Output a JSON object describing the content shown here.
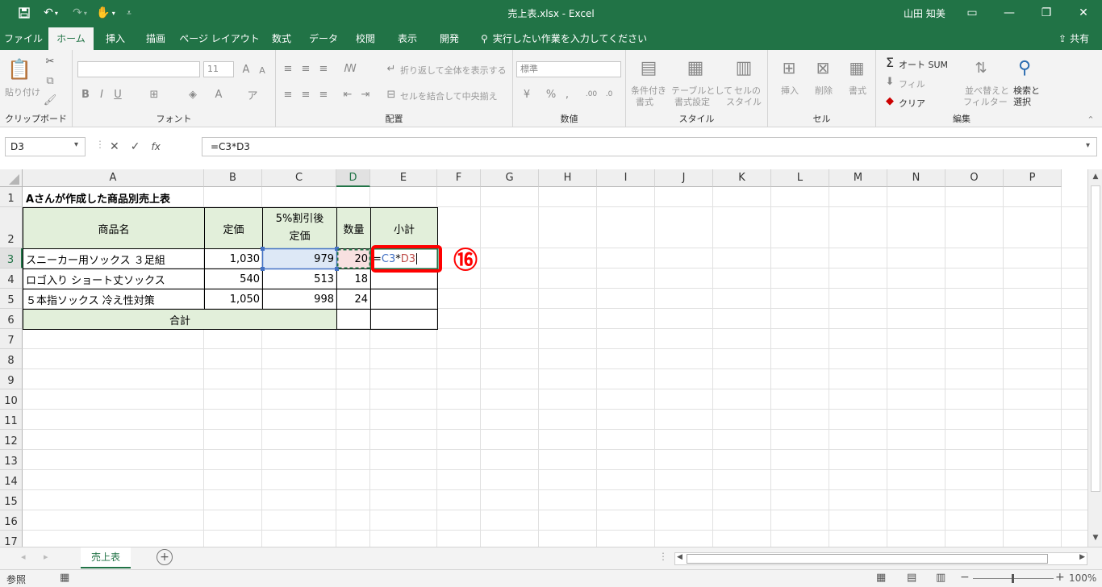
{
  "title_bar": {
    "title": "売上表.xlsx  -  Excel",
    "user": "山田 知美",
    "save_icon": "save-icon",
    "undo_icon": "undo-icon",
    "redo_icon": "redo-icon",
    "touch_icon": "touch-mode-icon",
    "customize_icon": "customize-qat-icon"
  },
  "tabs": [
    "ファイル",
    "ホーム",
    "挿入",
    "描画",
    "ページ レイアウト",
    "数式",
    "データ",
    "校閲",
    "表示",
    "開発"
  ],
  "active_tab": "ホーム",
  "tell_me": "実行したい作業を入力してください",
  "share": "共有",
  "ribbon": {
    "clipboard": {
      "label": "クリップボード",
      "paste": "貼り付け"
    },
    "font": {
      "label": "フォント",
      "size": "11"
    },
    "alignment": {
      "label": "配置",
      "wrap": "折り返して全体を表示する",
      "merge": "セルを結合して中央揃え"
    },
    "number": {
      "label": "数値",
      "format": "標準"
    },
    "styles": {
      "label": "スタイル",
      "conditional_1": "条件付き",
      "conditional_2": "書式",
      "table_1": "テーブルとして",
      "table_2": "書式設定",
      "cell_1": "セルの",
      "cell_2": "スタイル"
    },
    "cells": {
      "label": "セル",
      "insert": "挿入",
      "delete": "削除",
      "format": "書式"
    },
    "editing": {
      "label": "編集",
      "autosum": "オート SUM",
      "fill": "フィル",
      "clear": "クリア",
      "sort_1": "並べ替えと",
      "sort_2": "フィルター",
      "find_1": "検索と",
      "find_2": "選択"
    }
  },
  "formula_bar": {
    "name_box": "D3",
    "formula": "=C3*D3",
    "fx": "fx"
  },
  "columns": [
    "A",
    "B",
    "C",
    "D",
    "E",
    "F",
    "G",
    "H",
    "I",
    "J",
    "K",
    "L",
    "M",
    "N",
    "O",
    "P"
  ],
  "rows": [
    "1",
    "2",
    "3",
    "4",
    "5",
    "6",
    "7",
    "8",
    "9",
    "10",
    "11",
    "12",
    "13",
    "14",
    "15",
    "16",
    "17"
  ],
  "sheet": {
    "title": "Aさんが作成した商品別売上表",
    "headers": {
      "name": "商品名",
      "price": "定価",
      "discount_1": "5%割引後",
      "discount_2": "定価",
      "qty": "数量",
      "subtotal": "小計"
    },
    "items": [
      {
        "name": "スニーカー用ソックス ３足組",
        "price": "1,030",
        "discount": "979",
        "qty": "20"
      },
      {
        "name": "ロゴ入り ショート丈ソックス",
        "price": "540",
        "discount": "513",
        "qty": "18"
      },
      {
        "name": "５本指ソックス 冷え性対策",
        "price": "1,050",
        "discount": "998",
        "qty": "24"
      }
    ],
    "total_label": "合計",
    "editing_formula": {
      "eq": "=",
      "c3": "C3",
      "op": "*",
      "d3": "D3"
    }
  },
  "annotation": {
    "marker": "⑯",
    "color": "#ff0000"
  },
  "sheet_tab": "売上表",
  "status": {
    "mode": "参照",
    "zoom": "100%"
  },
  "colors": {
    "excel_green": "#217346",
    "header_fill": "#e2efda",
    "blue_ref": "#4472c4",
    "red_ref": "#c0504d"
  }
}
